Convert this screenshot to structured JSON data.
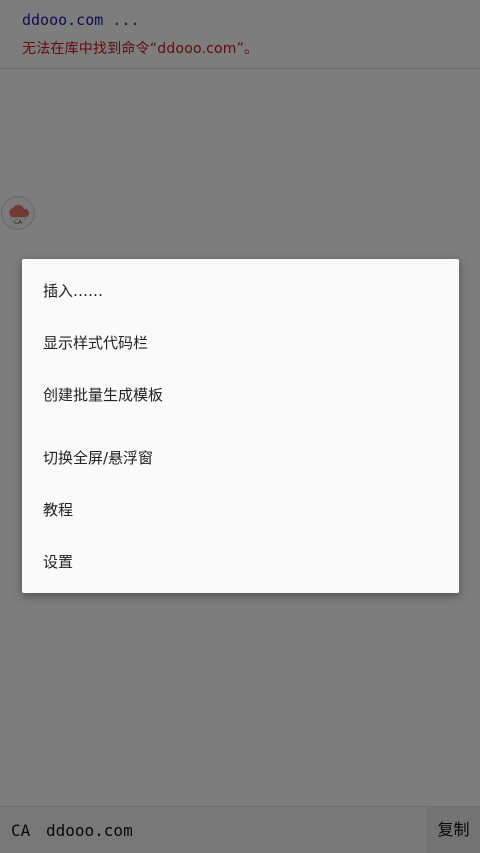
{
  "console": {
    "command": "ddooo.com",
    "ellipsis": " ...",
    "error": "无法在库中找到命令“ddooo.com”。"
  },
  "float_button": {
    "icon": "cloud-ca-icon",
    "label": "CA"
  },
  "bottom_bar": {
    "prompt": "CA",
    "input_value": "ddooo.com",
    "copy_label": "复制"
  },
  "menu": {
    "items": [
      {
        "label": "插入……"
      },
      {
        "label": "显示样式代码栏"
      },
      {
        "label": "创建批量生成模板"
      },
      {
        "label": "切换全屏/悬浮窗"
      },
      {
        "label": "教程"
      },
      {
        "label": "设置"
      }
    ]
  },
  "colors": {
    "command_text": "#1a1aa8",
    "error_text": "#c4161c",
    "scrim": "rgba(0,0,0,0.5)"
  }
}
